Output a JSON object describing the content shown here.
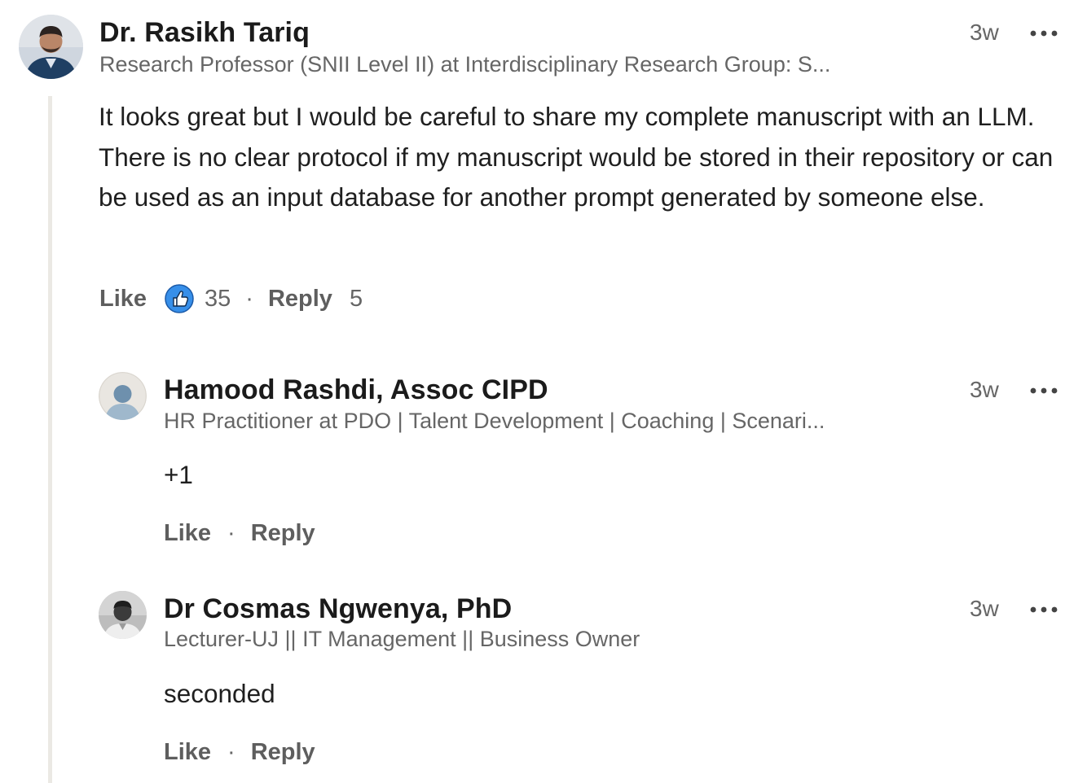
{
  "comments": [
    {
      "author": "Dr. Rasikh Tariq",
      "headline": "Research Professor (SNII Level II) at Interdisciplinary Research Group: S...",
      "time": "3w",
      "text": "It looks great but I would be careful to share my complete manuscript with an LLM. There is no clear protocol if my manuscript would be stored in their repository or can be used as an input database for another prompt generated by someone else.",
      "like_label": "Like",
      "reaction_icon": "thumbs-up-icon",
      "reaction_count": "35",
      "separator": "·",
      "reply_label": "Reply",
      "reply_count": "5"
    }
  ],
  "replies": [
    {
      "author": "Hamood Rashdi, Assoc CIPD",
      "headline": "HR Practitioner at PDO | Talent Development | Coaching | Scenari...",
      "time": "3w",
      "text": "+1",
      "like_label": "Like",
      "separator": "·",
      "reply_label": "Reply",
      "avatar_icon": "default-person-icon"
    },
    {
      "author": "Dr Cosmas Ngwenya, PhD",
      "headline": "Lecturer-UJ || IT Management || Business Owner",
      "time": "3w",
      "text": "seconded",
      "like_label": "Like",
      "separator": "·",
      "reply_label": "Reply",
      "avatar_icon": "profile-photo"
    }
  ],
  "colors": {
    "text_primary": "#1d1d1d",
    "text_secondary": "#666666",
    "thread_line": "#ebe9e4",
    "like_blue": "#378fe9"
  }
}
